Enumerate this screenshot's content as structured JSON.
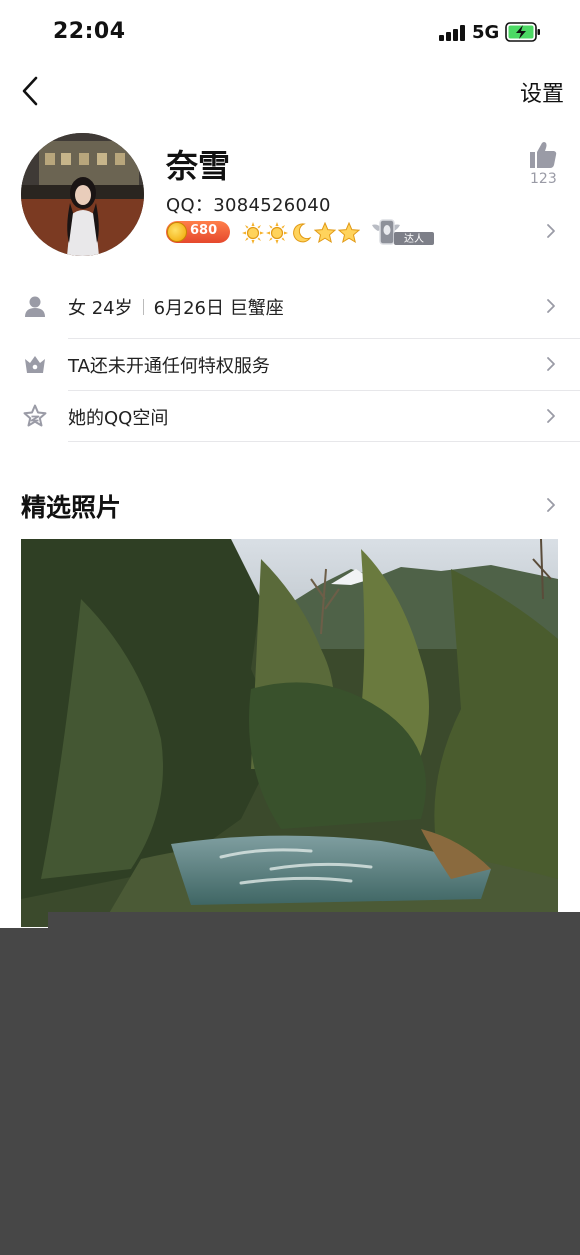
{
  "status_bar": {
    "time": "22:04",
    "network": "5G",
    "icons": [
      "signal-icon",
      "battery-charging-icon"
    ]
  },
  "nav": {
    "back_icon": "chevron-left-icon",
    "settings_label": "设置"
  },
  "profile": {
    "name": "奈雪",
    "qq_label": "QQ：3084526040",
    "coin_value": "680",
    "level_icons": [
      "sun-icon",
      "sun-icon",
      "moon-icon",
      "star-icon",
      "star-icon"
    ],
    "daren_label": "达人",
    "like_count": "123"
  },
  "info_rows": [
    {
      "icon": "person-icon",
      "gender_age": "女 24岁",
      "birthday": "6月26日 巨蟹座"
    },
    {
      "icon": "crown-icon",
      "label": "TA还未开通任何特权服务"
    },
    {
      "icon": "star-outline-icon",
      "label": "她的QQ空间"
    }
  ],
  "featured": {
    "title": "精选照片",
    "photo_subject": "mountain-stream-forest-photo"
  },
  "colors": {
    "icon_gray": "#9a9ba6",
    "divider": "#e7e7ea",
    "overlay": "#474747",
    "coin_badge": "#e5482d",
    "battery_green": "#4cd964"
  }
}
